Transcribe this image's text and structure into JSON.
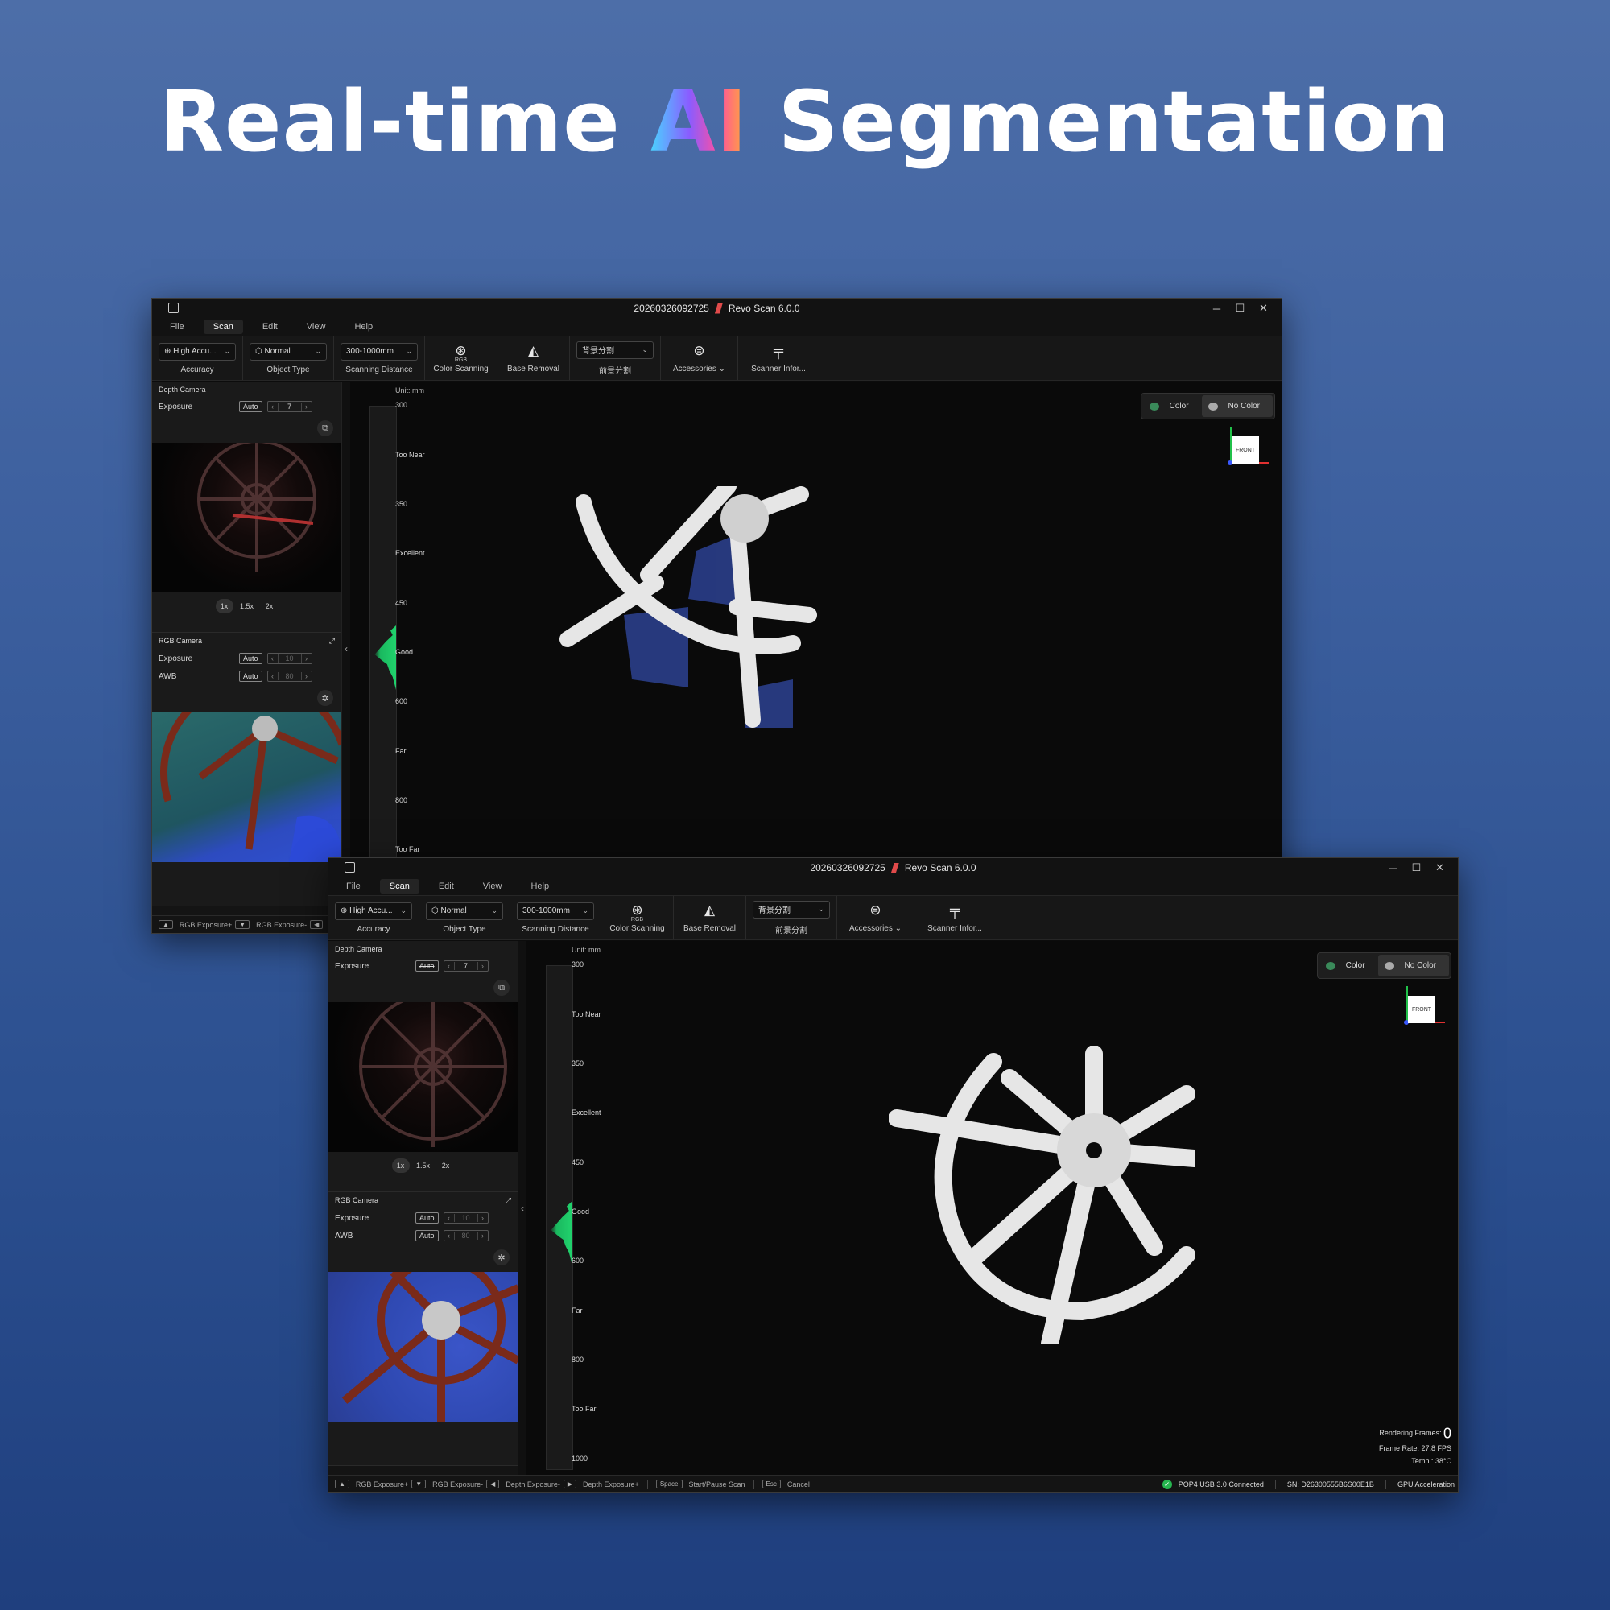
{
  "headline": {
    "before": "Real-time ",
    "highlight": "AI",
    "after": " Segmentation"
  },
  "window": {
    "title_id": "20260326092725",
    "app_name": "Revo Scan 6.0.0",
    "controls": [
      "─",
      "☐",
      "✕"
    ]
  },
  "menu": [
    "File",
    "Scan",
    "Edit",
    "View",
    "Help"
  ],
  "toolbar": {
    "accuracy_value": "High Accu...",
    "accuracy_label": "Accuracy",
    "object_value": "Normal",
    "object_label": "Object Type",
    "distance_value": "300-1000mm",
    "distance_label": "Scanning Distance",
    "color_scanning_label": "Color Scanning",
    "color_scanning_icon_text": "RGB",
    "base_removal_label": "Base Removal",
    "segment_value": "背景分割",
    "segment_label": "前景分割",
    "accessories_label": "Accessories",
    "scanner_info_label": "Scanner Infor..."
  },
  "depth_camera": {
    "title": "Depth Camera",
    "exposure_label": "Exposure",
    "auto_label": "Auto",
    "exposure_value": "7",
    "zoom": [
      "1x",
      "1.5x",
      "2x"
    ]
  },
  "rgb_camera": {
    "title": "RGB Camera",
    "exposure_label": "Exposure",
    "awb_label": "AWB",
    "auto_label": "Auto",
    "exposure_value": "10",
    "awb_value": "80"
  },
  "viewport": {
    "unit": "Unit: mm",
    "ticks": [
      "300",
      "Too Near",
      "350",
      "Excellent",
      "450",
      "Good",
      "600",
      "Far",
      "800",
      "Too Far",
      "1000"
    ],
    "color_btn": "Color",
    "nocolor_btn": "No Color",
    "front_label": "FRONT"
  },
  "stats": {
    "rendering_label": "Rendering Frames:",
    "rendering_value": "0",
    "frame_rate": "Frame Rate:  27.8 FPS",
    "temp": "Temp.:  38°C"
  },
  "statusbar": {
    "items": [
      "RGB Exposure+",
      "RGB Exposure-",
      "Depth Exposure-",
      "Depth Exposure+"
    ],
    "space_key": "Space",
    "space_action": "Start/Pause Scan",
    "esc_key": "Esc",
    "esc_action": "Cancel",
    "connection": "POP4 USB 3.0 Connected",
    "serial": "SN: D26300555B6S00E1B",
    "gpu": "GPU Acceleration",
    "truncated_item": "De"
  },
  "colors": {
    "accent_green": "#21d36d",
    "axis_red": "#e03030",
    "axis_green": "#21c14a",
    "axis_blue": "#3a58ff"
  }
}
